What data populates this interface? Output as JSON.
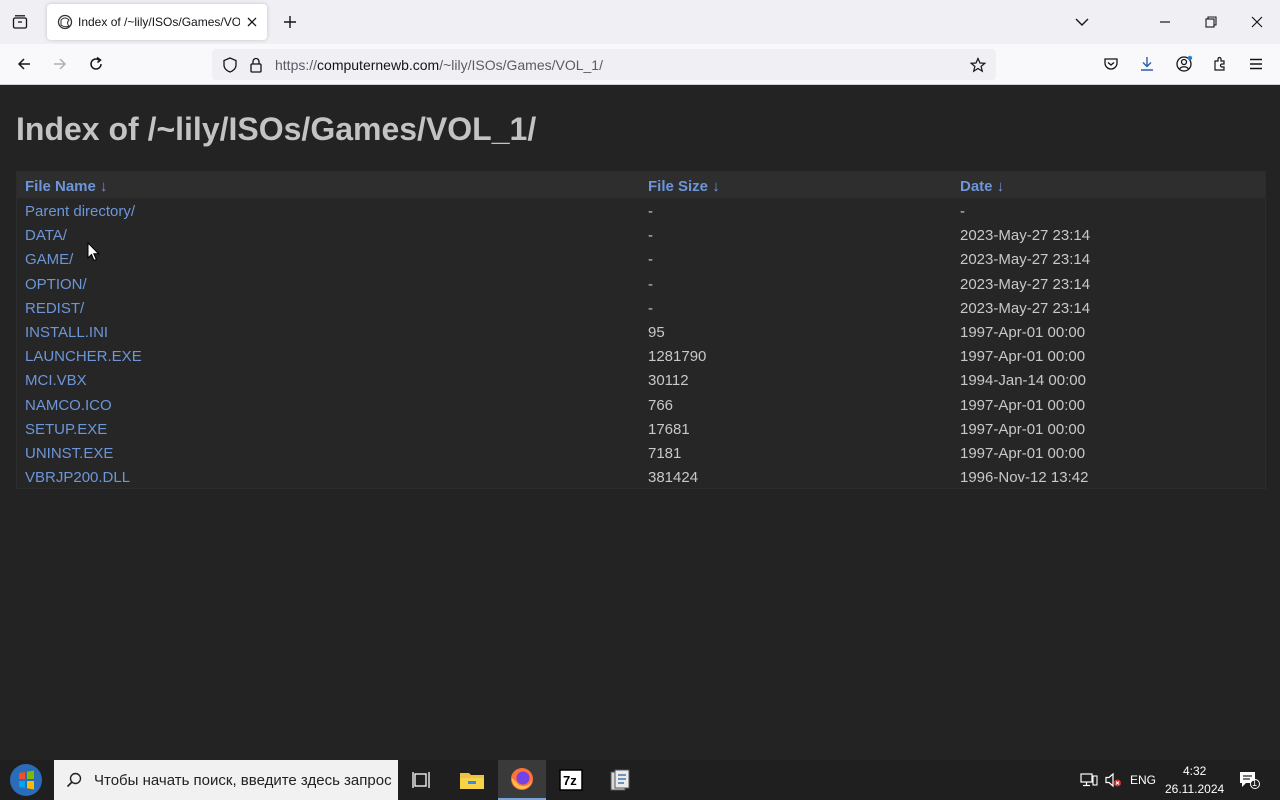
{
  "browser": {
    "tab_title": "Index of /~lily/ISOs/Games/VOL_1/",
    "url_scheme": "https://",
    "url_host": "computernewb.com",
    "url_path": "/~lily/ISOs/Games/VOL_1/"
  },
  "page": {
    "title": "Index of /~lily/ISOs/Games/VOL_1/",
    "columns": {
      "name": "File Name  ↓",
      "size": "File Size  ↓",
      "date": "Date  ↓"
    },
    "rows": [
      {
        "name": "Parent directory/",
        "size": "-",
        "date": "-"
      },
      {
        "name": "DATA/",
        "size": "-",
        "date": "2023-May-27 23:14"
      },
      {
        "name": "GAME/",
        "size": "-",
        "date": "2023-May-27 23:14"
      },
      {
        "name": "OPTION/",
        "size": "-",
        "date": "2023-May-27 23:14"
      },
      {
        "name": "REDIST/",
        "size": "-",
        "date": "2023-May-27 23:14"
      },
      {
        "name": "INSTALL.INI",
        "size": "95",
        "date": "1997-Apr-01 00:00"
      },
      {
        "name": "LAUNCHER.EXE",
        "size": "1281790",
        "date": "1997-Apr-01 00:00"
      },
      {
        "name": "MCI.VBX",
        "size": "30112",
        "date": "1994-Jan-14 00:00"
      },
      {
        "name": "NAMCO.ICO",
        "size": "766",
        "date": "1997-Apr-01 00:00"
      },
      {
        "name": "SETUP.EXE",
        "size": "17681",
        "date": "1997-Apr-01 00:00"
      },
      {
        "name": "UNINST.EXE",
        "size": "7181",
        "date": "1997-Apr-01 00:00"
      },
      {
        "name": "VBRJP200.DLL",
        "size": "381424",
        "date": "1996-Nov-12 13:42"
      }
    ]
  },
  "taskbar": {
    "search_placeholder": "Чтобы начать поиск, введите здесь запрос",
    "language": "ENG",
    "time": "4:32",
    "date": "26.11.2024",
    "notification_count": "1"
  },
  "icons": [
    "tab-list-icon",
    "page-favicon",
    "close-tab-icon",
    "new-tab-icon",
    "list-all-tabs-icon",
    "minimize-icon",
    "restore-icon",
    "close-window-icon",
    "back-icon",
    "forward-icon",
    "reload-icon",
    "tracking-protection-icon",
    "lock-icon",
    "bookmark-star-icon",
    "pocket-icon",
    "downloads-icon",
    "account-icon",
    "extensions-icon",
    "menu-icon",
    "mouse-cursor",
    "windows-start-icon",
    "search-icon",
    "task-view-icon",
    "file-explorer-icon",
    "firefox-icon",
    "7zip-icon",
    "app-icon",
    "network-icon",
    "volume-muted-icon",
    "notification-icon"
  ],
  "colors": {
    "link": "#6d96d9",
    "page_bg": "#232323",
    "heading": "#c3c3c3"
  }
}
